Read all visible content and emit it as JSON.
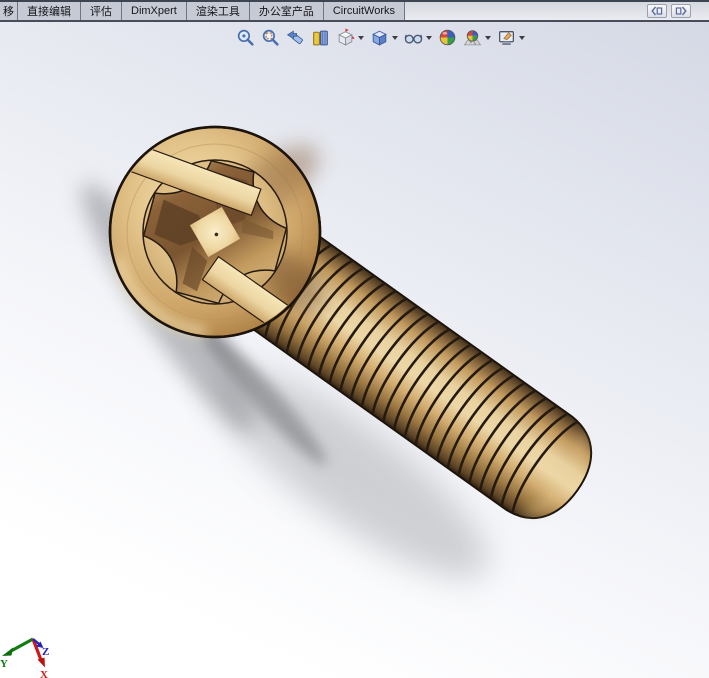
{
  "command_manager": {
    "tabs": [
      {
        "label": "移",
        "truncated": true
      },
      {
        "label": "直接编辑",
        "truncated": false
      },
      {
        "label": "评估",
        "truncated": false
      },
      {
        "label": "DimXpert",
        "truncated": false
      },
      {
        "label": "渲染工具",
        "truncated": false
      },
      {
        "label": "办公室产品",
        "truncated": false
      },
      {
        "label": "CircuitWorks",
        "truncated": false
      }
    ],
    "toggle_buttons": [
      {
        "icon": "dock-collapse-left-icon"
      },
      {
        "icon": "dock-expand-right-icon"
      }
    ]
  },
  "view_toolbar": {
    "items": [
      {
        "icon": "zoom-to-fit-icon",
        "dropdown": false
      },
      {
        "icon": "zoom-to-area-icon",
        "dropdown": false
      },
      {
        "icon": "previous-view-icon",
        "dropdown": false
      },
      {
        "icon": "section-view-icon",
        "dropdown": false
      },
      {
        "icon": "view-orientation-icon",
        "dropdown": true
      },
      {
        "icon": "display-style-icon",
        "dropdown": true
      },
      {
        "icon": "hide-show-items-icon",
        "dropdown": true
      },
      {
        "icon": "edit-appearance-icon",
        "dropdown": false
      },
      {
        "icon": "apply-scene-icon",
        "dropdown": true
      },
      {
        "icon": "view-settings-icon",
        "dropdown": true
      }
    ]
  },
  "viewport": {
    "model_name": "phillips-pan-head-screw",
    "material": {
      "base_gold": "#d2ab70",
      "highlight_gold": "#f2dfae",
      "dark_gold": "#6b4e2c",
      "recess_brown": "#6d4b2a",
      "outline": "#1d140b"
    },
    "background": {
      "top_right": "#d5d9e5",
      "bottom_left": "#ffffff"
    },
    "shadow_color": "#8f9094",
    "thread_count": 24
  },
  "orientation_triad": {
    "axes": [
      {
        "label": "Y",
        "color": "#0f7d0f"
      },
      {
        "label": "X",
        "color": "#cf1a1a"
      },
      {
        "label": "Z",
        "color": "#2424bb"
      }
    ]
  }
}
